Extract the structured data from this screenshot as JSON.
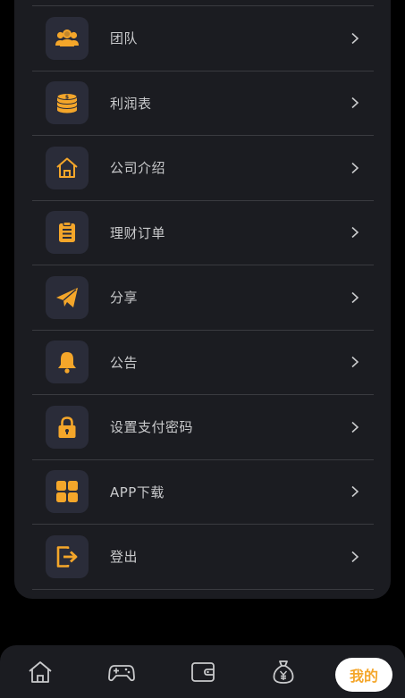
{
  "menu": {
    "items": [
      {
        "label": "团队",
        "icon": "team-icon"
      },
      {
        "label": "利润表",
        "icon": "coins-icon"
      },
      {
        "label": "公司介绍",
        "icon": "home-outline-icon"
      },
      {
        "label": "理财订单",
        "icon": "clipboard-icon"
      },
      {
        "label": "分享",
        "icon": "paper-plane-icon"
      },
      {
        "label": "公告",
        "icon": "bell-icon"
      },
      {
        "label": "设置支付密码",
        "icon": "lock-icon"
      },
      {
        "label": "APP下载",
        "icon": "grid-icon"
      },
      {
        "label": "登出",
        "icon": "logout-icon"
      }
    ]
  },
  "tabbar": {
    "items": [
      {
        "icon": "home-icon"
      },
      {
        "icon": "gamepad-icon"
      },
      {
        "icon": "wallet-icon"
      },
      {
        "icon": "money-bag-icon"
      }
    ],
    "active_label": "我的"
  },
  "colors": {
    "accent": "#f4a62a",
    "card": "#1b1c21",
    "icon_box": "#2a2c39",
    "divider": "#3a3b40",
    "text": "#c9cacc"
  }
}
